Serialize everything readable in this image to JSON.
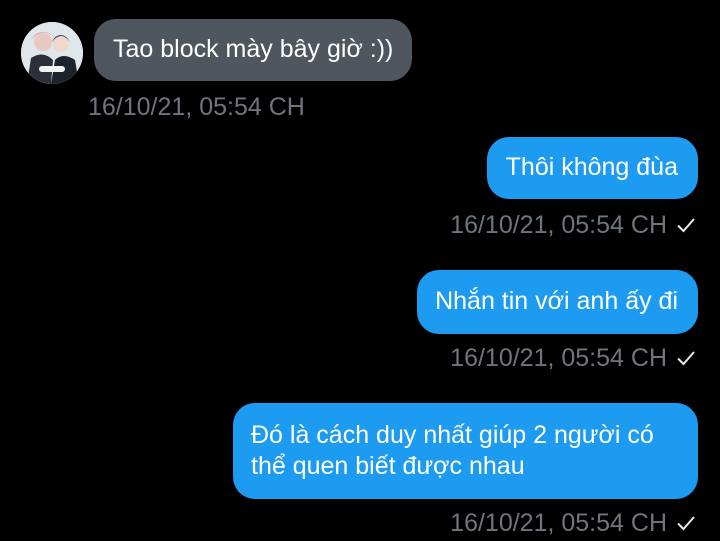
{
  "conversation": {
    "messages": [
      {
        "direction": "received",
        "text": "Tao block mày bây giờ :))",
        "timestamp": "16/10/21, 05:54 CH",
        "read": false
      },
      {
        "direction": "sent",
        "text": "Thôi không đùa",
        "timestamp": "16/10/21, 05:54 CH",
        "read": true
      },
      {
        "direction": "sent",
        "text": "Nhắn tin với anh ấy đi",
        "timestamp": "16/10/21, 05:54 CH",
        "read": true
      },
      {
        "direction": "sent",
        "lines": [
          "Đó là cách duy nhất giúp 2 người có",
          "thể quen biết được nhau"
        ],
        "timestamp": "16/10/21, 05:54 CH",
        "read": true
      }
    ]
  },
  "theme": {
    "background": "#000000",
    "received_bubble": "#4f565d",
    "sent_bubble": "#1d9bf0",
    "timestamp_color": "#6e767d",
    "text_color": "#ffffff"
  },
  "icons": {
    "avatar": "user-avatar-photo",
    "read_receipt": "check-icon"
  }
}
